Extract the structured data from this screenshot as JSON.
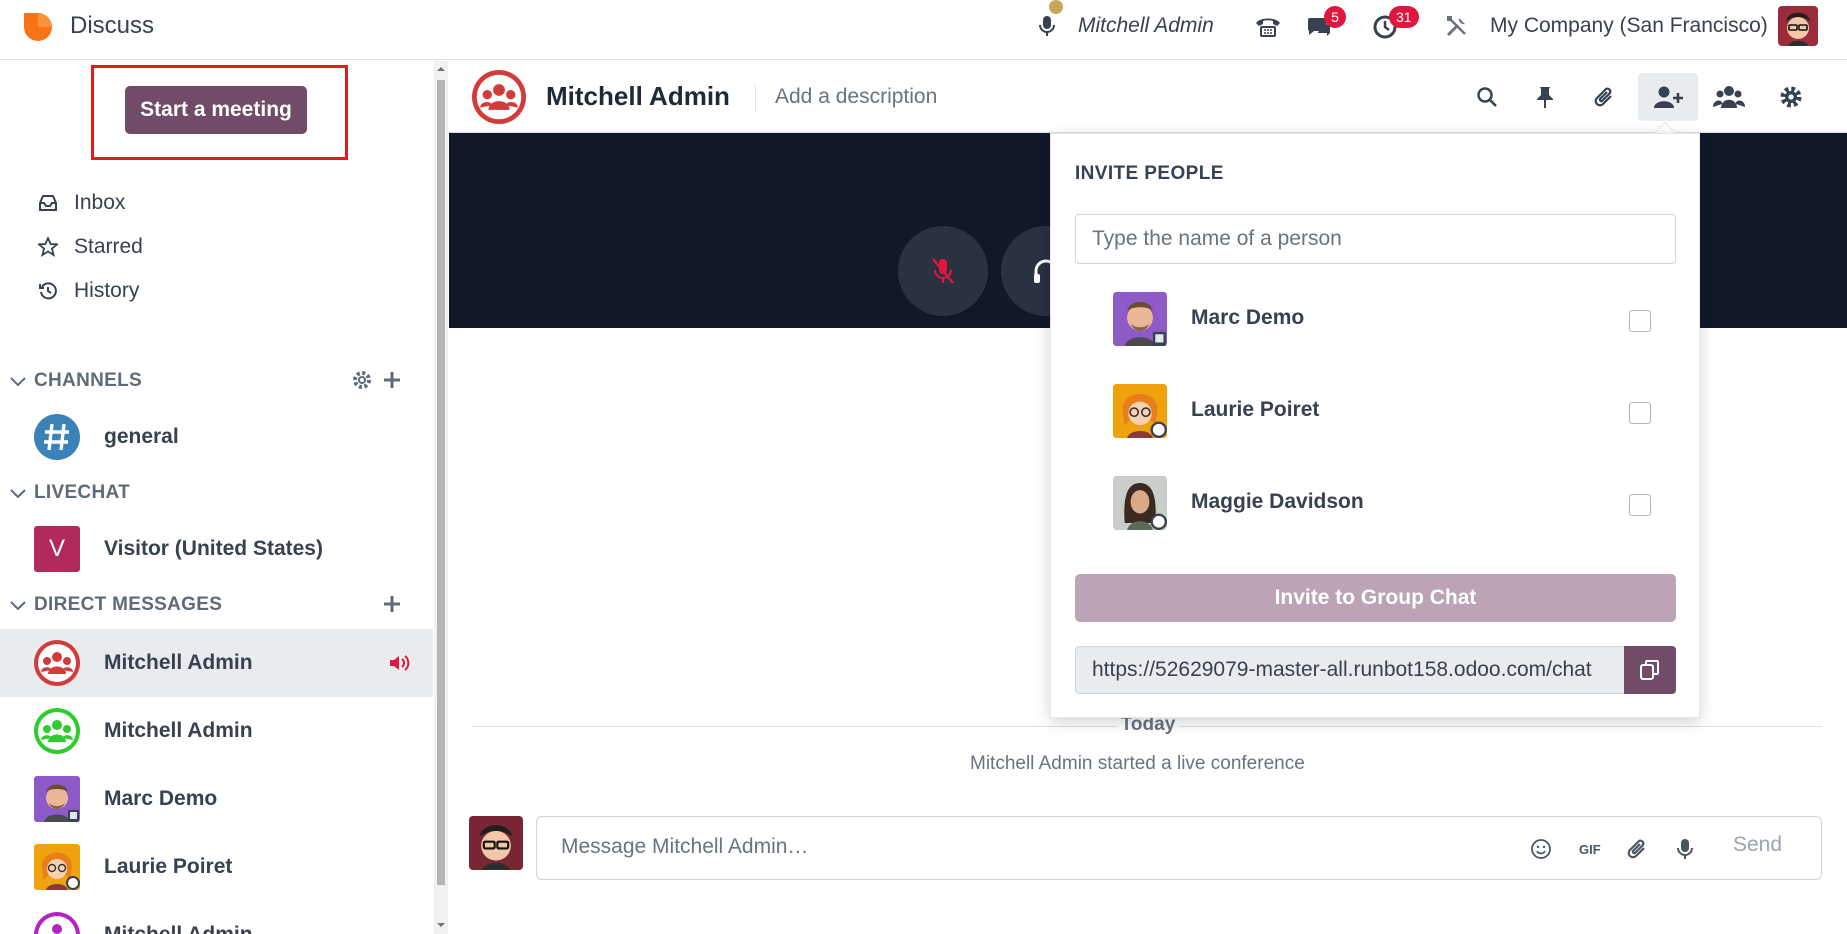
{
  "app": {
    "title": "Discuss"
  },
  "navbar": {
    "user_name": "Mitchell Admin",
    "chat_badge": "5",
    "activity_badge": "31",
    "company": "My Company (San Francisco)"
  },
  "sidebar": {
    "start_meeting": "Start a meeting",
    "mailboxes": [
      {
        "label": "Inbox",
        "icon": "inbox-icon"
      },
      {
        "label": "Starred",
        "icon": "star-icon"
      },
      {
        "label": "History",
        "icon": "history-icon"
      }
    ],
    "categories": {
      "channels": "CHANNELS",
      "livechat": "LIVECHAT",
      "direct_messages": "DIRECT MESSAGES"
    },
    "channels": [
      {
        "name": "general"
      }
    ],
    "livechat": [
      {
        "name": "Visitor (United States)",
        "initial": "V"
      }
    ],
    "direct_messages": [
      {
        "name": "Mitchell Admin",
        "active": true
      },
      {
        "name": "Mitchell Admin"
      },
      {
        "name": "Marc Demo"
      },
      {
        "name": "Laurie Poiret"
      },
      {
        "name": "Mitchell Admin"
      }
    ]
  },
  "thread": {
    "name": "Mitchell Admin",
    "description_placeholder": "Add a description",
    "date_separator": "Today",
    "notification": "Mitchell Admin started a live conference",
    "composer_placeholder": "Message Mitchell Admin…",
    "send_label": "Send"
  },
  "invite": {
    "title": "INVITE PEOPLE",
    "search_placeholder": "Type the name of a person",
    "people": [
      {
        "name": "Marc Demo"
      },
      {
        "name": "Laurie Poiret"
      },
      {
        "name": "Maggie Davidson"
      }
    ],
    "invite_button": "Invite to Group Chat",
    "link": "https://52629079-master-all.runbot158.odoo.com/chat"
  },
  "colors": {
    "brand": "#714b67",
    "badge": "#e0163e",
    "highlight": "#e41b1b",
    "call_bg": "#111827"
  }
}
